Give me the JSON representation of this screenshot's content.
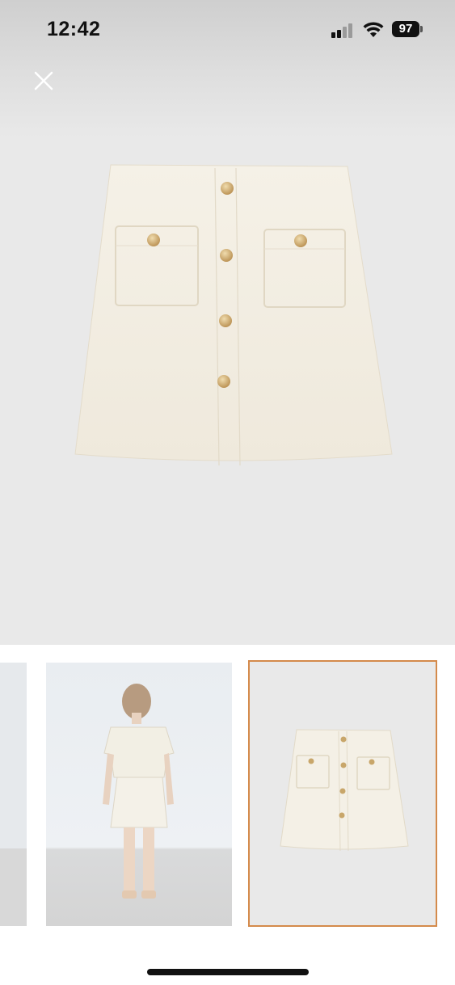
{
  "status_bar": {
    "time": "12:42",
    "battery_level": "97",
    "signal_icon": "cellular-signal-icon",
    "wifi_icon": "wifi-icon"
  },
  "viewer": {
    "close_icon": "close-icon",
    "main_image": "skirt-front-image",
    "thumbnails": [
      {
        "name": "thumbnail-previous",
        "selected": false
      },
      {
        "name": "thumbnail-model-back-view",
        "selected": false
      },
      {
        "name": "thumbnail-skirt-front",
        "selected": true
      }
    ]
  },
  "colors": {
    "selected_outline": "#d48a4b",
    "fabric": "#f3efe5",
    "button_gold": "#c8a66a"
  }
}
